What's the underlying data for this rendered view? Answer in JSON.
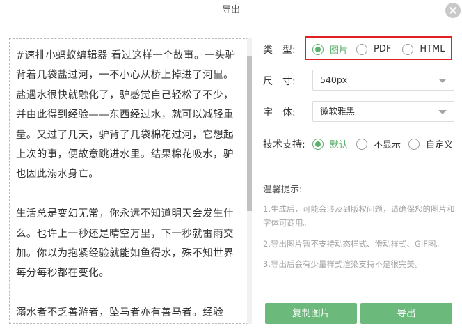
{
  "dialog": {
    "title": "导出",
    "close_icon": "close-icon"
  },
  "preview": {
    "paragraphs": [
      "#速排小蚂蚁编辑器 看过这样一个故事。一头驴背着几袋盐过河，一不小心从桥上掉进了河里。盐遇水很快就融化了，驴感觉自己轻松了不少，并由此得到经验——东西经过水，就可以减轻重量。又过了几天，驴背了几袋棉花过河，它想起上次的事，便故意跳进水里。结果棉花吸水，驴也因此溺水身亡。",
      "生活总是变幻无常，你永远不知道明天会发生什么。也许上一秒还是晴空万里，下一秒就雷雨交加。你以为抱紧经验就能如鱼得水，殊不知世界每分每秒都在变化。",
      "溺水者不乏善游者，坠马者亦有善马者。经验"
    ]
  },
  "settings": {
    "type": {
      "label": "类　型:",
      "options": [
        {
          "label": "图片",
          "checked": true
        },
        {
          "label": "PDF",
          "checked": false
        },
        {
          "label": "HTML",
          "checked": false
        }
      ]
    },
    "size": {
      "label": "尺　寸:",
      "value": "540px"
    },
    "font": {
      "label": "字　体:",
      "value": "微软雅黑"
    },
    "support": {
      "label": "技术支持:",
      "options": [
        {
          "label": "默认",
          "checked": true
        },
        {
          "label": "不显示",
          "checked": false
        },
        {
          "label": "自定义",
          "checked": false
        }
      ]
    }
  },
  "tips": {
    "title": "温馨提示:",
    "items": [
      "1.生成后，可能会涉及到版权问题，请确保您的图片和字体可商用。",
      "2.导出图片暂不支持动态样式、滑动样式、GIF图。",
      "3.导出后会有少量样式渲染支持不是很完美。"
    ]
  },
  "buttons": {
    "copy_image": "复制图片",
    "export": "导出"
  },
  "colors": {
    "accent": "#5cb06d",
    "button": "#6bb97b",
    "highlight_border": "#e02222"
  }
}
